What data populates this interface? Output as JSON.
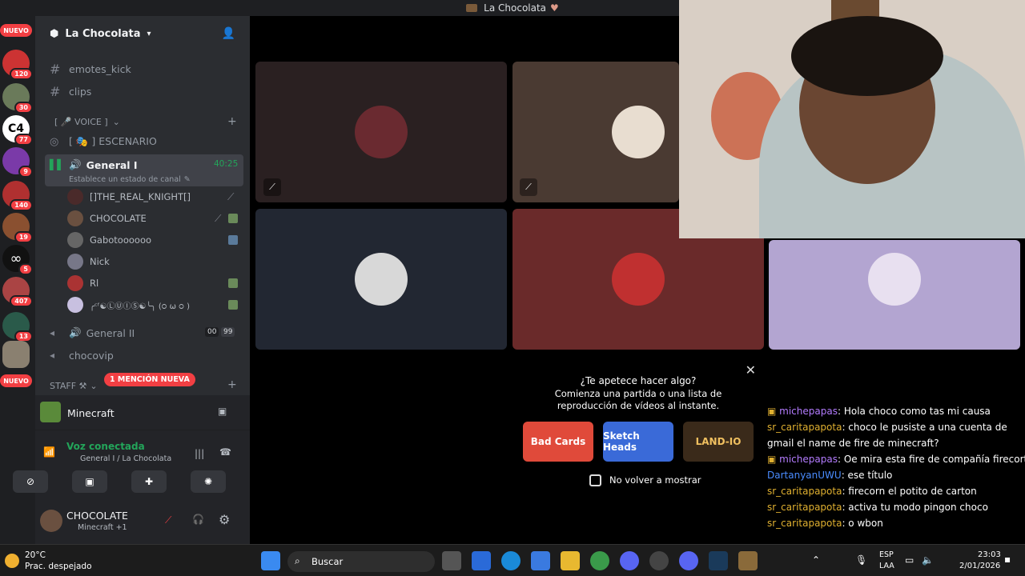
{
  "window_title": "La Chocolata",
  "server": {
    "name": "La Chocolata"
  },
  "server_rail": {
    "new_label_top": "NUEVO",
    "new_label_bottom": "NUEVO",
    "badges": [
      "120",
      "30",
      "77",
      "9",
      "140",
      "19",
      "5",
      "407",
      "13"
    ]
  },
  "channels": {
    "text": [
      "emotes_kick",
      "clips"
    ],
    "voice_category": "[ 🎤 VOICE ]",
    "stage": "[ 🎭 ] ESCENARIO",
    "general1": {
      "name": "General I",
      "status": "Establece un estado de canal",
      "time": "40:25"
    },
    "voice_users": [
      "[]THE_REAL_KNIGHT[]",
      "CHOCOLATE",
      "Gabotoooooo",
      "Nick",
      "Rl",
      "╭ᶜᶠ☯ⓁⓊⒾⓈ☯╰╮ (੦ ω ੦ )"
    ],
    "general2": {
      "name": "General II",
      "count_a": "00",
      "count_b": "99"
    },
    "chocovip": "chocovip",
    "staff_category": "STAFF ⚒",
    "mention_pill": "1 MENCIÓN NUEVA"
  },
  "activity": {
    "name": "Minecraft"
  },
  "voice_connection": {
    "status": "Voz conectada",
    "location": "General I / La Chocolata"
  },
  "user": {
    "name": "CHOCOLATE",
    "status": "Minecraft +1"
  },
  "popup": {
    "title": "¿Te apetece hacer algo?",
    "body": "Comienza una partida o una lista de reproducción de vídeos al instante.",
    "games": [
      "Bad Cards",
      "Sketch Heads",
      "LAND-IO"
    ],
    "checkbox": "No volver a mostrar"
  },
  "chat": [
    {
      "user": "michepapas",
      "text": ": Hola choco como tas mi causa",
      "color": "#b47cff",
      "badge": true
    },
    {
      "user": "sr_caritapapota",
      "text": ": choco le pusiste a una cuenta de gmail el name de fire de minecraft?",
      "color": "#e0b030",
      "badge": false
    },
    {
      "user": "michepapas",
      "text": ": Oe mira esta fire de compañía firecort",
      "color": "#b47cff",
      "badge": true
    },
    {
      "user": "DartanyanUWU",
      "text": ": ese título",
      "color": "#4a8cff",
      "badge": false
    },
    {
      "user": "sr_caritapapota",
      "text": ": firecorn el potito de carton",
      "color": "#e0b030",
      "badge": false
    },
    {
      "user": "sr_caritapapota",
      "text": ": activa tu modo pingon choco",
      "color": "#e0b030",
      "badge": false
    },
    {
      "user": "sr_caritapapota",
      "text": ": o wbon",
      "color": "#e0b030",
      "badge": false
    }
  ],
  "taskbar": {
    "weather_temp": "20°C",
    "weather_desc": "Prac. despejado",
    "search": "Buscar",
    "lang_top": "ESP",
    "lang_bottom": "LAA",
    "time": "23:03",
    "date": "2/01/2026"
  }
}
